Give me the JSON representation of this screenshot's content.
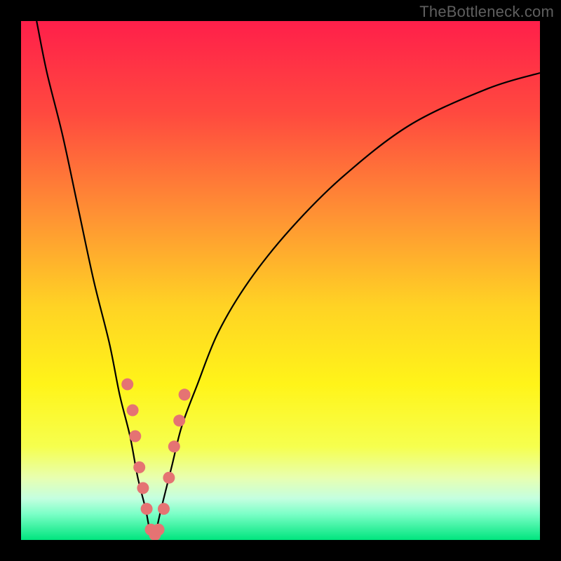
{
  "watermark": {
    "text": "TheBottleneck.com"
  },
  "gradient": {
    "stops": [
      {
        "pct": 0,
        "color": "#ff1f4a"
      },
      {
        "pct": 18,
        "color": "#ff4a3f"
      },
      {
        "pct": 38,
        "color": "#ff9433"
      },
      {
        "pct": 55,
        "color": "#ffd324"
      },
      {
        "pct": 70,
        "color": "#fff419"
      },
      {
        "pct": 82,
        "color": "#f6ff4e"
      },
      {
        "pct": 88,
        "color": "#e8ffb0"
      },
      {
        "pct": 92,
        "color": "#c4ffe0"
      },
      {
        "pct": 95,
        "color": "#7bffc7"
      },
      {
        "pct": 100,
        "color": "#00e57e"
      }
    ]
  },
  "chart_data": {
    "type": "line",
    "title": "",
    "xlabel": "",
    "ylabel": "",
    "xlim": [
      0,
      100
    ],
    "ylim": [
      0,
      100
    ],
    "series": [
      {
        "name": "bottleneck-curve",
        "x": [
          3,
          5,
          8,
          11,
          14,
          17,
          19,
          21,
          22.5,
          24,
          25,
          25.8,
          27,
          29,
          31,
          34,
          38,
          44,
          52,
          62,
          75,
          90,
          100
        ],
        "y": [
          100,
          90,
          78,
          64,
          50,
          38,
          28,
          20,
          12,
          6,
          1,
          1,
          6,
          14,
          22,
          30,
          40,
          50,
          60,
          70,
          80,
          87,
          90
        ]
      }
    ],
    "markers": {
      "name": "highlight-dots",
      "color": "#e57373",
      "points": [
        {
          "x": 20.5,
          "y": 30
        },
        {
          "x": 21.5,
          "y": 25
        },
        {
          "x": 22.0,
          "y": 20
        },
        {
          "x": 22.8,
          "y": 14
        },
        {
          "x": 23.5,
          "y": 10
        },
        {
          "x": 24.2,
          "y": 6
        },
        {
          "x": 25.0,
          "y": 2
        },
        {
          "x": 25.8,
          "y": 1
        },
        {
          "x": 26.5,
          "y": 2
        },
        {
          "x": 27.5,
          "y": 6
        },
        {
          "x": 28.5,
          "y": 12
        },
        {
          "x": 29.5,
          "y": 18
        },
        {
          "x": 30.5,
          "y": 23
        },
        {
          "x": 31.5,
          "y": 28
        }
      ]
    }
  }
}
